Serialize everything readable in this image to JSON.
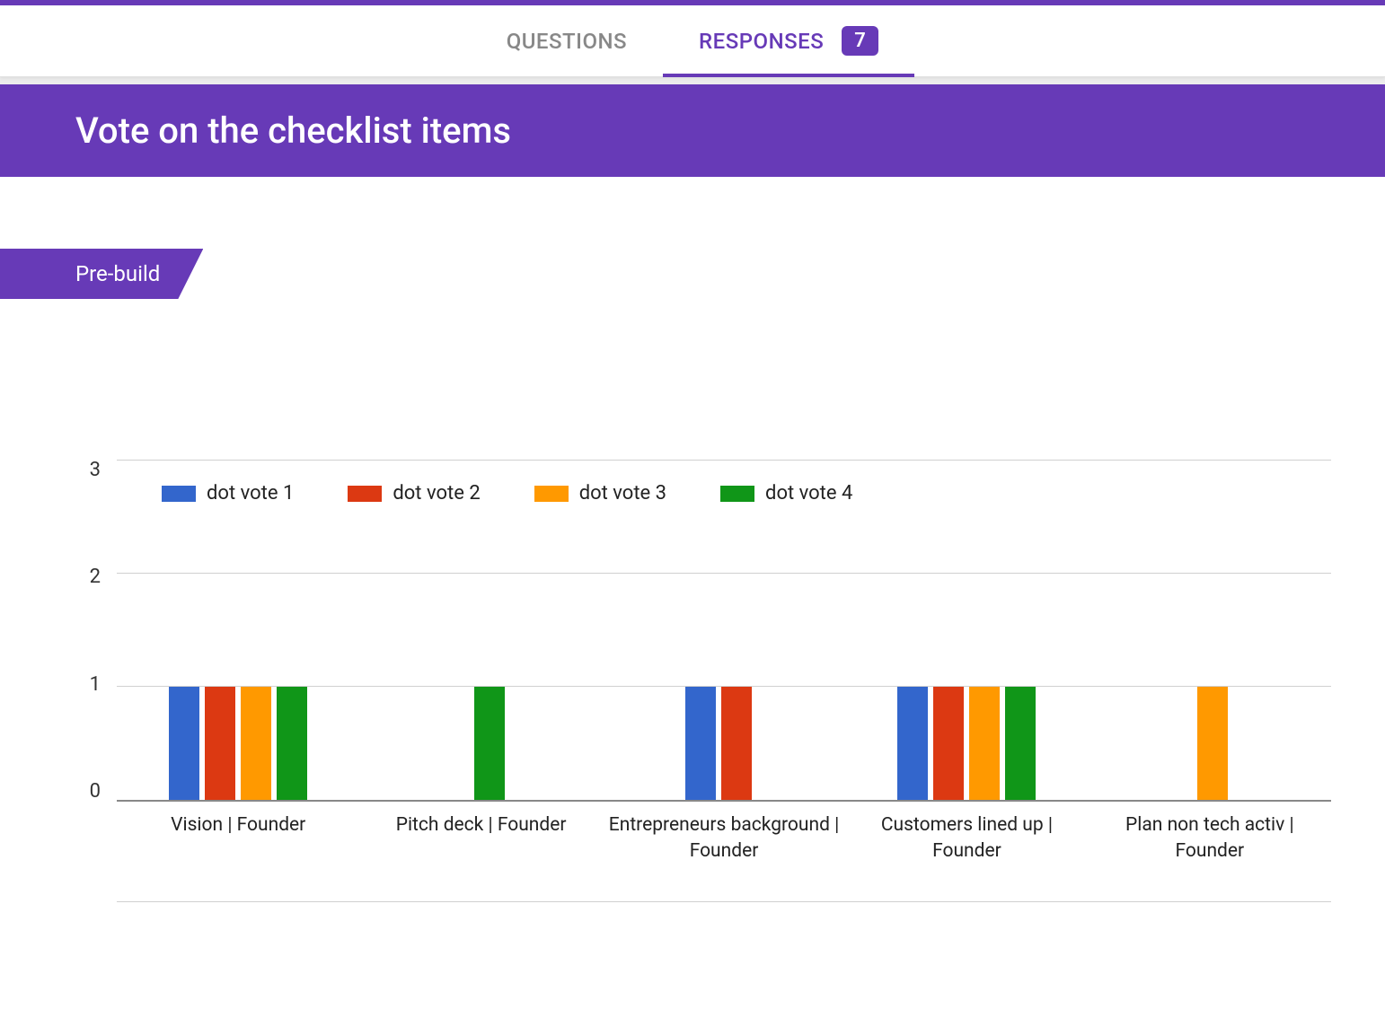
{
  "tabs": {
    "questions": "QUESTIONS",
    "responses": "RESPONSES",
    "badge": "7"
  },
  "header": {
    "title": "Vote on the checklist items"
  },
  "section": {
    "label": "Pre-build"
  },
  "chart_data": {
    "type": "bar",
    "ylim": [
      0,
      3
    ],
    "yticks": [
      0,
      1,
      2,
      3
    ],
    "categories": [
      "Vision | Founder",
      "Pitch deck | Founder",
      "Entrepreneurs background | Founder",
      "Customers lined up | Founder",
      "Plan non tech activ | Founder"
    ],
    "series": [
      {
        "name": "dot vote 1",
        "color": "#3366cc",
        "values": [
          1,
          0,
          1,
          1,
          0
        ]
      },
      {
        "name": "dot vote 2",
        "color": "#dc3912",
        "values": [
          1,
          0,
          1,
          1,
          0
        ]
      },
      {
        "name": "dot vote 3",
        "color": "#ff9900",
        "values": [
          1,
          0,
          0,
          1,
          1
        ]
      },
      {
        "name": "dot vote 4",
        "color": "#109618",
        "values": [
          1,
          1,
          0,
          1,
          0
        ]
      }
    ]
  }
}
